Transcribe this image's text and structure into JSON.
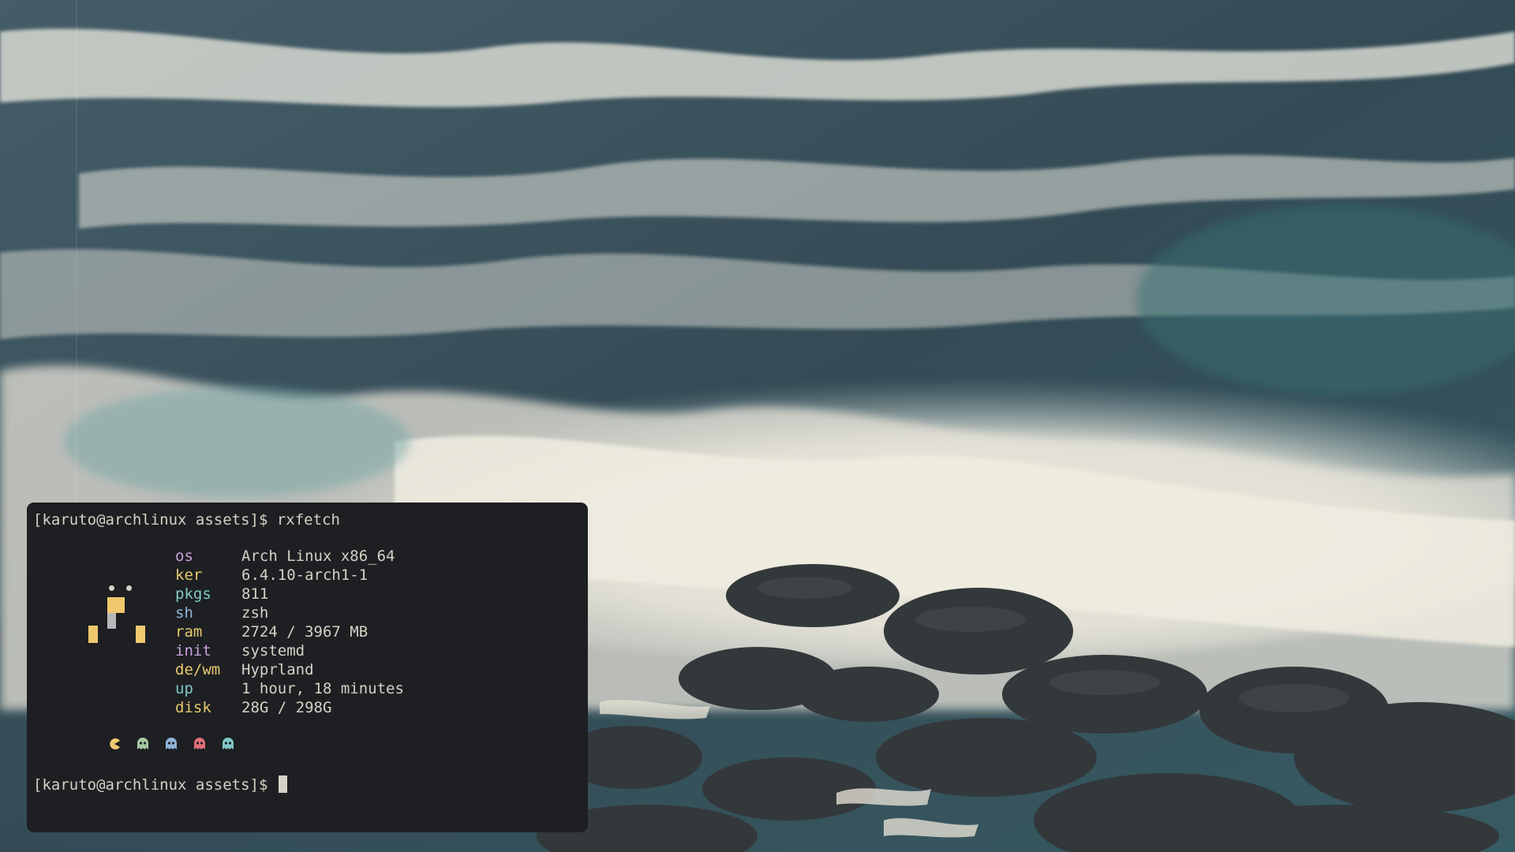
{
  "wallpaper": {
    "description_colors": {
      "sea_dark": "#2f4a57",
      "foam": "#e9e6dc",
      "rock": "#2a3035"
    }
  },
  "terminal": {
    "background": "#1d1f22",
    "prompt_1": "[karuto@archlinux assets]$ rxfetch",
    "prompt_2": "[karuto@archlinux assets]$ ",
    "info": [
      {
        "key": "os",
        "value": "Arch Linux x86_64",
        "color": "#c9a0dc"
      },
      {
        "key": "ker",
        "value": "6.4.10-arch1-1",
        "color": "#e6c86e"
      },
      {
        "key": "pkgs",
        "value": "811",
        "color": "#7fc8c8"
      },
      {
        "key": "sh",
        "value": "zsh",
        "color": "#8fb4d8"
      },
      {
        "key": "ram",
        "value": "2724 / 3967 MB",
        "color": "#e6c86e"
      },
      {
        "key": "init",
        "value": "systemd",
        "color": "#c9a0dc"
      },
      {
        "key": "de/wm",
        "value": "Hyprland",
        "color": "#e6c86e"
      },
      {
        "key": "up",
        "value": "1 hour, 18 minutes",
        "color": "#7fc8c8"
      },
      {
        "key": "disk",
        "value": "28G / 298G",
        "color": "#e6c86e"
      }
    ],
    "logo": {
      "eye_color": "#d4d2c6",
      "head_color": "#f0c86e",
      "neck_color": "#b8b8b8",
      "feet_color": "#f0c86e"
    },
    "ghosts": [
      {
        "name": "pacman-icon",
        "color": "#f0c86e"
      },
      {
        "name": "ghost-green-icon",
        "color": "#a8c8a0"
      },
      {
        "name": "ghost-blue-icon",
        "color": "#8fb4d8"
      },
      {
        "name": "ghost-red-icon",
        "color": "#e0707a"
      },
      {
        "name": "ghost-cyan-icon",
        "color": "#7fc8c8"
      }
    ]
  }
}
